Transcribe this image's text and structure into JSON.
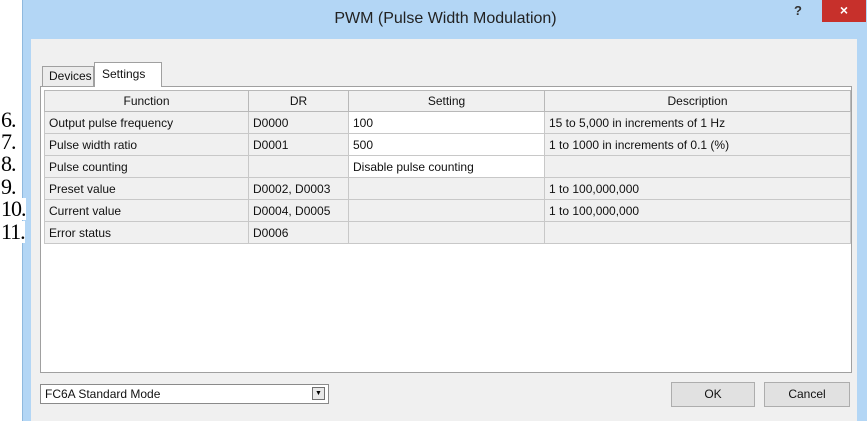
{
  "window": {
    "title": "PWM (Pulse Width Modulation)",
    "help_label": "?",
    "close_label": "×"
  },
  "tabs": [
    {
      "label": "Devices",
      "active": false
    },
    {
      "label": "Settings",
      "active": true
    }
  ],
  "table": {
    "columns": [
      "Function",
      "DR",
      "Setting",
      "Description"
    ],
    "rows": [
      {
        "number": "6.",
        "function": "Output pulse frequency",
        "dr": "D0000",
        "setting": "100",
        "description": "15 to 5,000 in increments of 1 Hz"
      },
      {
        "number": "7.",
        "function": "Pulse width ratio",
        "dr": "D0001",
        "setting": "500",
        "description": "1 to 1000 in increments of 0.1 (%)"
      },
      {
        "number": "8.",
        "function": "Pulse counting",
        "dr": "",
        "setting": "Disable pulse counting",
        "description": ""
      },
      {
        "number": "9.",
        "function": "Preset value",
        "dr": "D0002, D0003",
        "setting": "",
        "description": "1 to 100,000,000"
      },
      {
        "number": "10.",
        "function": "Current value",
        "dr": "D0004, D0005",
        "setting": "",
        "description": "1 to 100,000,000"
      },
      {
        "number": "11.",
        "function": "Error status",
        "dr": "D0006",
        "setting": "",
        "description": ""
      }
    ]
  },
  "mode_select": {
    "value": "FC6A Standard Mode",
    "icon": "dropdown-arrow-icon"
  },
  "buttons": {
    "ok": "OK",
    "cancel": "Cancel"
  },
  "colors": {
    "title_bar": "#b3d6f5",
    "close_button": "#c7302b",
    "client": "#f0f0f0"
  }
}
